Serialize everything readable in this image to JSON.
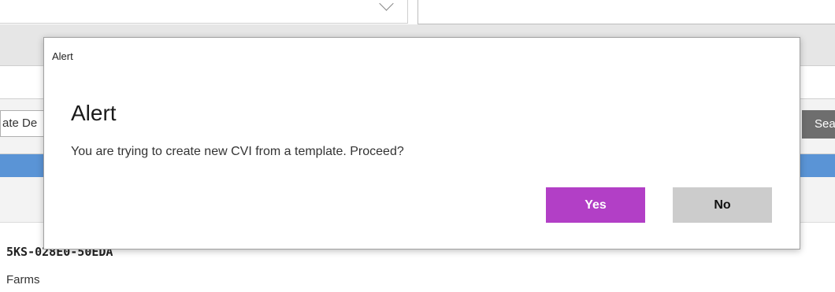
{
  "background": {
    "date_field_text": "ate De",
    "search_button_label": "Sea",
    "record_id": "5KS-028E0-50EDA",
    "farms_label": "Farms"
  },
  "dialog": {
    "title_bar": "Alert",
    "heading": "Alert",
    "message": "You are trying to create new CVI from a template. Proceed?",
    "yes_label": "Yes",
    "no_label": "No"
  },
  "colors": {
    "yes_button": "#b23fc6",
    "no_button": "#cccccc",
    "blue_bar": "#5a94d6"
  },
  "icons": [
    "chevron-down-icon"
  ]
}
